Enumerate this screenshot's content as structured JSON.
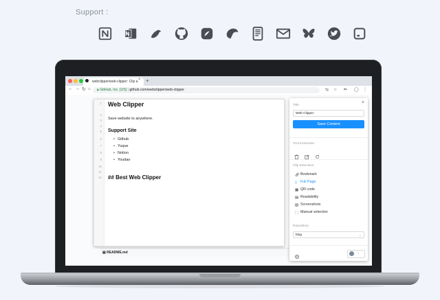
{
  "support": {
    "label": "Support :",
    "services": [
      {
        "name": "notion",
        "icon": "notion-icon"
      },
      {
        "name": "onenote",
        "icon": "onenote-icon"
      },
      {
        "name": "bear",
        "icon": "bear-icon"
      },
      {
        "name": "github",
        "icon": "github-icon"
      },
      {
        "name": "yuque",
        "icon": "yuque-icon"
      },
      {
        "name": "youdao",
        "icon": "youdao-icon"
      },
      {
        "name": "kindle",
        "icon": "kindle-icon"
      },
      {
        "name": "mail",
        "icon": "mail-icon"
      },
      {
        "name": "butterfly",
        "icon": "butterfly-icon"
      },
      {
        "name": "twitter",
        "icon": "twitter-icon"
      },
      {
        "name": "dash",
        "icon": "dash-icon"
      }
    ]
  },
  "browser": {
    "tab_title": "webclipper/web-clipper: Clip a",
    "tab_close": "×",
    "new_tab": "+",
    "url_org": "GitHub, Inc. [US]",
    "url_sep": " | ",
    "url_path": "github.com/webclipper/web-clipper",
    "file_name": "README.md"
  },
  "editor": {
    "line_numbers": [
      "1",
      "2",
      "3",
      "4",
      "5",
      "6",
      "7",
      "8",
      "9",
      "10",
      "11",
      "12"
    ],
    "title": "Web Clipper",
    "tagline": "Save website  to anywhere.",
    "section": "Support Site",
    "list": [
      "Github",
      "Yuque",
      "Notion",
      "Youdao"
    ],
    "footer_heading": "## Best Web Clipper"
  },
  "panel": {
    "close": "×",
    "title_label": "Title",
    "title_value": "Web Clipper",
    "save_label": "Save Content",
    "tool_label": "Tool Extension",
    "clip_label": "Clip Extension",
    "clip_items": [
      {
        "label": "Bookmark",
        "active": false
      },
      {
        "label": "Full Page",
        "active": true
      },
      {
        "label": "QR code",
        "active": false
      },
      {
        "label": "Readability",
        "active": false
      },
      {
        "label": "Screenshots",
        "active": false
      },
      {
        "label": "Manual selection",
        "active": false
      }
    ],
    "repo_label": "Repository",
    "repo_value": "blog",
    "caret": "⌄"
  },
  "colors": {
    "accent": "#1890ff",
    "background": "#f1f4fa",
    "icon": "#4a4d52"
  }
}
